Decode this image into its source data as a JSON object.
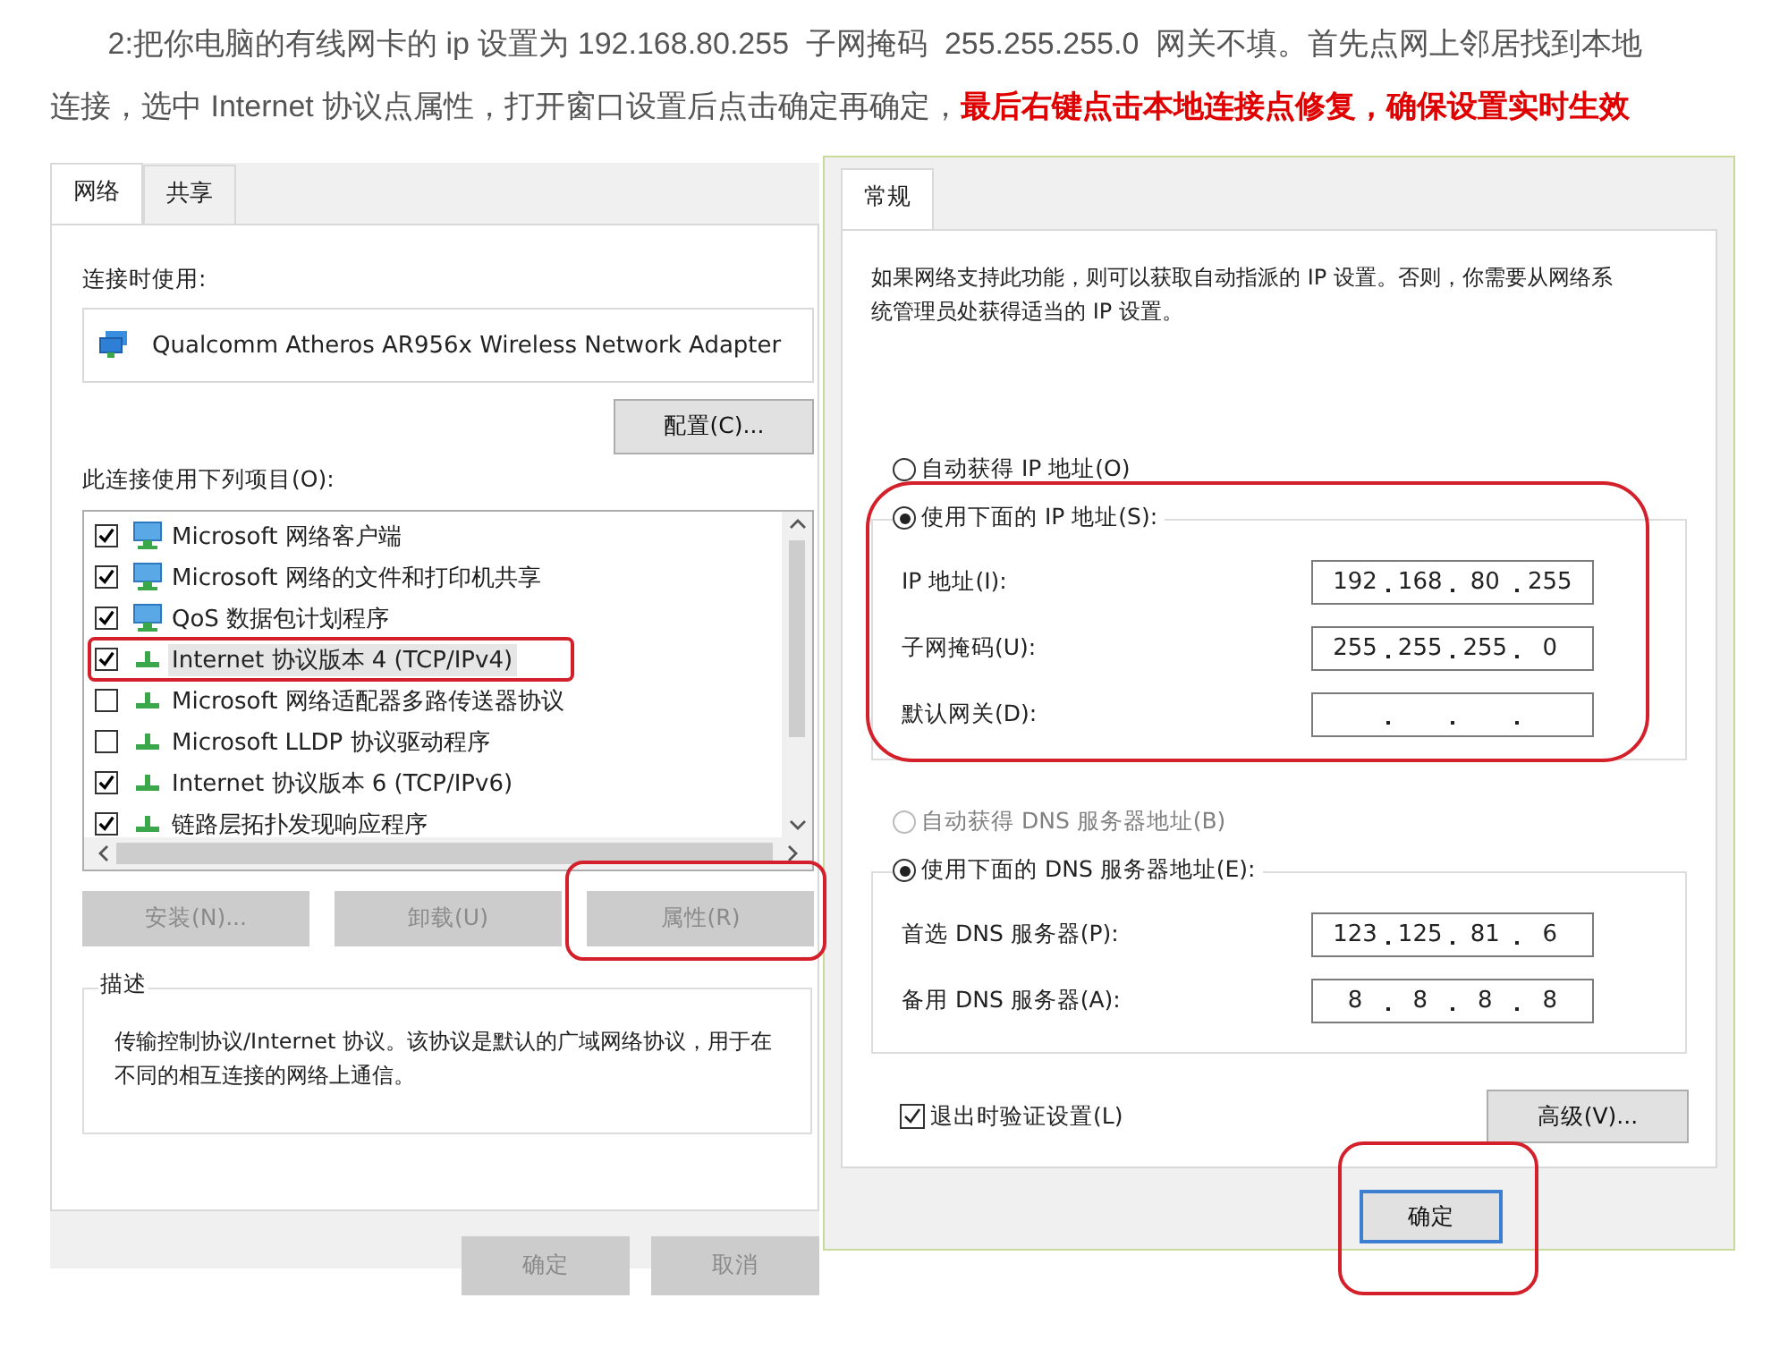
{
  "instruction": {
    "text": "2:把你电脑的有线网卡的 ip 设置为 192.168.80.255  子网掩码  255.255.255.0  网关不填。首先点网上邻居找到本地连接，选中 Internet 协议点属性，打开窗口设置后点击确定再确定，",
    "emphasis": "最后右键点击本地连接点修复，确保设置实时生效"
  },
  "adapter_dialog": {
    "tabs": [
      {
        "label": "网络",
        "selected": true
      },
      {
        "label": "共享",
        "selected": false
      }
    ],
    "connect_using_label": "连接时使用:",
    "adapter": "Qualcomm Atheros AR956x Wireless Network Adapter",
    "configure_button": "配置(C)...",
    "items_label": "此连接使用下列项目(O):",
    "items": [
      {
        "label": "Microsoft 网络客户端",
        "checked": true,
        "kind": "client",
        "selected": false,
        "annotated": false
      },
      {
        "label": "Microsoft 网络的文件和打印机共享",
        "checked": true,
        "kind": "client",
        "selected": false,
        "annotated": false
      },
      {
        "label": "QoS 数据包计划程序",
        "checked": true,
        "kind": "client",
        "selected": false,
        "annotated": false
      },
      {
        "label": "Internet 协议版本 4 (TCP/IPv4)",
        "checked": true,
        "kind": "protocol",
        "selected": true,
        "annotated": true
      },
      {
        "label": "Microsoft 网络适配器多路传送器协议",
        "checked": false,
        "kind": "protocol",
        "selected": false,
        "annotated": false
      },
      {
        "label": "Microsoft LLDP 协议驱动程序",
        "checked": false,
        "kind": "protocol",
        "selected": false,
        "annotated": false
      },
      {
        "label": "Internet 协议版本 6 (TCP/IPv6)",
        "checked": true,
        "kind": "protocol",
        "selected": false,
        "annotated": false
      },
      {
        "label": "链路层拓扑发现响应程序",
        "checked": true,
        "kind": "protocol",
        "selected": false,
        "annotated": false
      }
    ],
    "item_buttons": [
      {
        "label": "安装(N)...",
        "disabled": true,
        "annotated": false
      },
      {
        "label": "卸载(U)",
        "disabled": true,
        "annotated": false
      },
      {
        "label": "属性(R)",
        "disabled": true,
        "annotated": true
      }
    ],
    "description_title": "描述",
    "description": "传输控制协议/Internet 协议。该协议是默认的广域网络协议，用于在不同的相互连接的网络上通信。",
    "footer_buttons": [
      {
        "label": "确定",
        "disabled": true
      },
      {
        "label": "取消",
        "disabled": true
      }
    ]
  },
  "ipv4_dialog": {
    "tabs": [
      {
        "label": "常规",
        "selected": true
      }
    ],
    "intro": "如果网络支持此功能，则可以获取自动指派的 IP 设置。否则，你需要从网络系统管理员处获得适当的 IP 设置。",
    "ip_auto": {
      "label": "自动获得 IP 地址(O)",
      "selected": false,
      "disabled": false
    },
    "ip_manual": {
      "label": "使用下面的 IP 地址(S):",
      "selected": true,
      "disabled": false,
      "annotated": true
    },
    "ip_fields": [
      {
        "label": "IP 地址(I):",
        "octets": [
          "192",
          "168",
          "80",
          "255"
        ]
      },
      {
        "label": "子网掩码(U):",
        "octets": [
          "255",
          "255",
          "255",
          "0"
        ]
      },
      {
        "label": "默认网关(D):"
      }
    ],
    "dns_auto": {
      "label": "自动获得 DNS 服务器地址(B)",
      "selected": false,
      "disabled": true
    },
    "dns_manual": {
      "label": "使用下面的 DNS 服务器地址(E):",
      "selected": true,
      "disabled": false
    },
    "dns_fields": [
      {
        "label": "首选 DNS 服务器(P):",
        "octets": [
          "123",
          "125",
          "81",
          "6"
        ]
      },
      {
        "label": "备用 DNS 服务器(A):",
        "octets": [
          "8",
          "8",
          "8",
          "8"
        ]
      }
    ],
    "validate": {
      "label": "退出时验证设置(L)",
      "checked": true
    },
    "advanced_button": "高级(V)...",
    "ok_button": {
      "label": "确定",
      "annotated": true
    }
  }
}
